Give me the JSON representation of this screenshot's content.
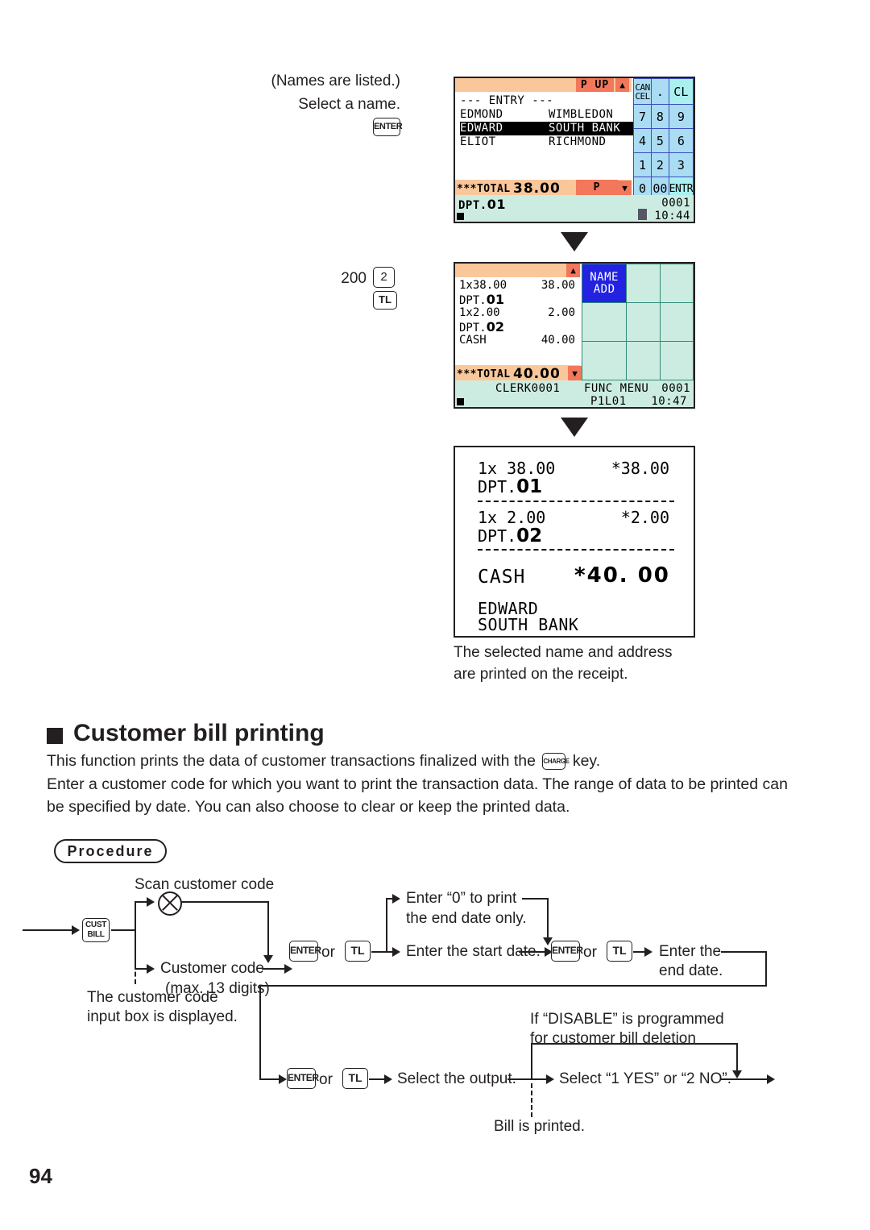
{
  "page": {
    "number": "94"
  },
  "step1": {
    "note_line1": "(Names are listed.)",
    "note_line2": "Select a name.",
    "key_enter": "ENTER"
  },
  "step2": {
    "amount": "200",
    "key_dept": "2",
    "key_tl": "TL"
  },
  "display1": {
    "header_label": "--- ENTRY ---",
    "page_up": "P UP",
    "page_down": "P DOWN",
    "up_arrow": "icon-up-triangle",
    "down_arrow": "icon-down-triangle",
    "rows": [
      {
        "name": "EDMOND",
        "address": "WIMBLEDON",
        "selected": false
      },
      {
        "name": "EDWARD",
        "address": "SOUTH BANK",
        "selected": true
      },
      {
        "name": "ELIOT",
        "address": "RICHMOND",
        "selected": false
      }
    ],
    "total_label": "***TOTAL",
    "total_value": "38.00",
    "status_dept": "DPT.",
    "status_dept_num": "01",
    "status_counter": "0001",
    "status_time": "10:44",
    "keypad": [
      [
        "CAN\nCEL",
        ".",
        "CL"
      ],
      [
        "7",
        "8",
        "9"
      ],
      [
        "4",
        "5",
        "6"
      ],
      [
        "1",
        "2",
        "3"
      ],
      [
        "0",
        "00",
        "ENTR"
      ]
    ]
  },
  "display2": {
    "up_arrow": "icon-up-triangle",
    "lines": [
      {
        "left": "1x38.00",
        "right": "38.00"
      },
      {
        "left": "DPT.",
        "num": "01",
        "right": ""
      },
      {
        "left": "1x2.00",
        "right": "2.00"
      },
      {
        "left": "DPT.",
        "num": "02",
        "right": ""
      },
      {
        "left": "CASH",
        "right": "40.00"
      }
    ],
    "total_label": "***TOTAL",
    "total_value": "40.00",
    "func_key_line1": "NAME",
    "func_key_line2": "ADD",
    "status_clerk": "CLERK0001",
    "status_func": "FUNC MENU",
    "status_counter": "0001",
    "status_p1l01": "P1L01",
    "status_time": "10:47"
  },
  "receipt": {
    "line1_qty": "1x 38.00",
    "line1_amt": "*38.00",
    "line1_dept": "DPT.",
    "line1_dept_num": "01",
    "line2_qty": "1x 2.00",
    "line2_amt": "*2.00",
    "line2_dept": "DPT.",
    "line2_dept_num": "02",
    "cash_label": "CASH",
    "cash_amt": "*40. 00",
    "cust_name": "EDWARD",
    "cust_addr": "SOUTH BANK"
  },
  "receipt_caption": {
    "line1": "The selected name and address",
    "line2": "are printed on the receipt."
  },
  "section": {
    "heading": "Customer bill printing",
    "para1_before": "This function prints the data of customer transactions finalized with the",
    "para1_key": "CHARGE",
    "para1_after": "key.",
    "para2_line1": "Enter a customer code for which you want to print the transaction data. The range of data to be printed can",
    "para2_line2": "be specified by date. You can also choose to clear or keep the printed data."
  },
  "procedure": {
    "badge": "Procedure",
    "scan_label": "Scan customer code",
    "scan_icon": "scanner-circle-icon",
    "cust_bill_key_line1": "CUST",
    "cust_bill_key_line2": "BILL",
    "cust_code_line1": "Customer code",
    "cust_code_line2": "(max. 13 digits)",
    "note_box_line1": "The customer code",
    "note_box_line2": "input box is displayed.",
    "key_enter": "ENTER",
    "or_label": "or",
    "key_tl": "TL",
    "enter0_line1": "Enter “0” to print",
    "enter0_line2": "the end date only.",
    "start_date": "Enter the start date.",
    "end_date_line1": "Enter the",
    "end_date_line2": "end date.",
    "disable_line1": "If “DISABLE” is programmed",
    "disable_line2": "for customer bill deletion",
    "select_output": "Select the output.",
    "select_yesno": "Select “1 YES” or “2 NO”.",
    "bill_printed": "Bill is printed."
  }
}
